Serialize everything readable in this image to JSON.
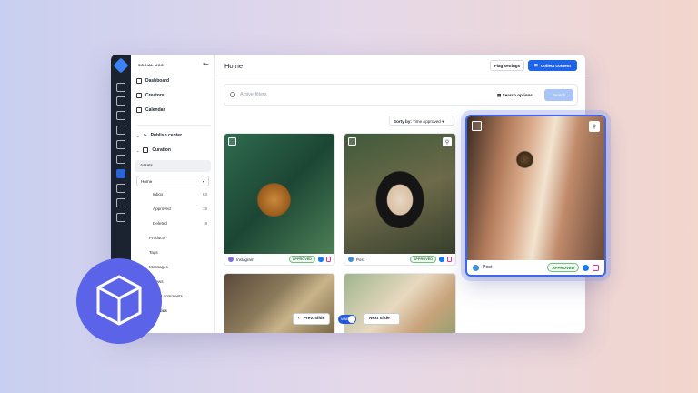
{
  "sidebar": {
    "brand": "SOCIAL UGC",
    "items": [
      {
        "label": "Dashboard"
      },
      {
        "label": "Creators"
      },
      {
        "label": "Calendar"
      },
      {
        "label": "Publish center"
      },
      {
        "label": "Curation"
      }
    ],
    "sub": {
      "assets": "Assets",
      "home_select": "Home",
      "inbox": "Inbox",
      "inbox_count": "63",
      "approved": "Approved",
      "approved_count": "19",
      "deleted": "Deleted",
      "deleted_count": "8",
      "products": "Products",
      "tags": "Tags",
      "messages": "Messages",
      "reviews": "views",
      "comments": "out comments",
      "analytics": "lytics"
    }
  },
  "header": {
    "title": "Home",
    "flag_settings": "Flag settings",
    "collect_content": "Collect content"
  },
  "search": {
    "placeholder": "Active filters",
    "options": "Search options",
    "button": "Search"
  },
  "sort": {
    "label": "Sorty by:",
    "value": "Time Approved"
  },
  "cards": [
    {
      "source": "Instagram",
      "status": "APPROVED"
    },
    {
      "source": "Post",
      "status": "APPROVED"
    }
  ],
  "featured": {
    "source": "Post",
    "status": "APPROVED"
  },
  "carousel": {
    "prev": "Prev. slide",
    "toggle": "MINE",
    "next": "Next slide"
  },
  "colors": {
    "accent": "#1f63ea",
    "approved": "#2f8a45",
    "highlight": "#3f67e8",
    "cube_bg": "#5b63e8"
  }
}
